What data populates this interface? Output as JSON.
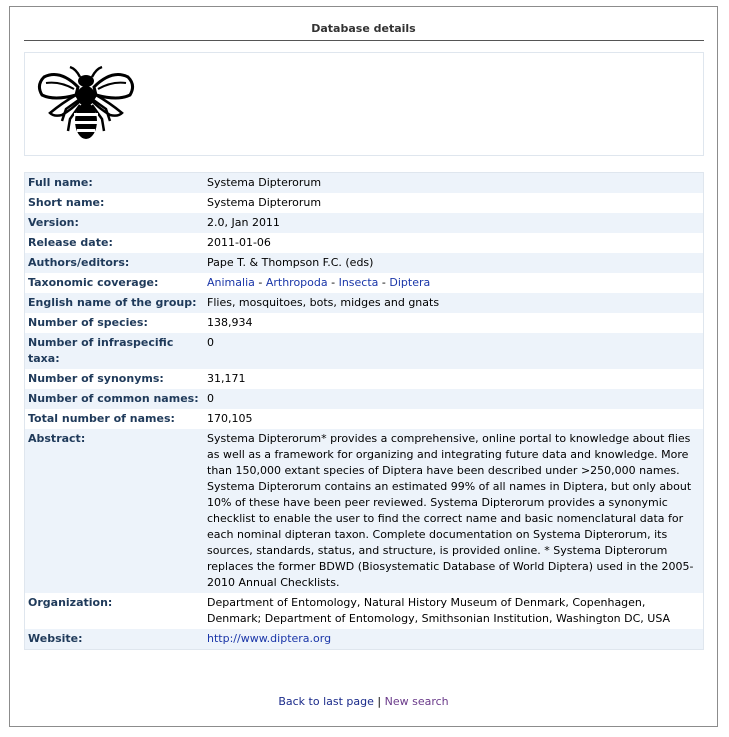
{
  "page": {
    "title": "Database details"
  },
  "logo": {
    "icon": "bee-icon"
  },
  "details": {
    "full_name": {
      "label": "Full name:",
      "value": "Systema Dipterorum"
    },
    "short_name": {
      "label": "Short name:",
      "value": "Systema Dipterorum"
    },
    "version": {
      "label": "Version:",
      "value": "2.0, Jan 2011"
    },
    "release_date": {
      "label": "Release date:",
      "value": "2011-01-06"
    },
    "authors": {
      "label": "Authors/editors:",
      "value": "Pape T. & Thompson F.C. (eds)"
    },
    "taxonomic": {
      "label": "Taxonomic coverage:",
      "items": [
        "Animalia",
        "Arthropoda",
        "Insecta",
        "Diptera"
      ],
      "separator": " - "
    },
    "english_name": {
      "label": "English name of the group:",
      "value": "Flies, mosquitoes, bots, midges and gnats"
    },
    "num_species": {
      "label": "Number of species:",
      "value": "138,934"
    },
    "num_infraspecific": {
      "label": "Number of infraspecific taxa:",
      "value": "0"
    },
    "num_synonyms": {
      "label": "Number of synonyms:",
      "value": "31,171"
    },
    "num_common": {
      "label": "Number of common names:",
      "value": "0"
    },
    "total_names": {
      "label": "Total number of names:",
      "value": "170,105"
    },
    "abstract": {
      "label": "Abstract:",
      "value": "Systema Dipterorum* provides a comprehensive, online portal to knowledge about flies as well as a framework for organizing and integrating future data and knowledge. More than 150,000 extant species of Diptera have been described under >250,000 names. Systema Dipterorum contains an estimated 99% of all names in Diptera, but only about 10% of these have been peer reviewed. Systema Dipterorum provides a synonymic checklist to enable the user to find the correct name and basic nomenclatural data for each nominal dipteran taxon. Complete documentation on Systema Dipterorum, its sources, standards, status, and structure, is provided online. * Systema Dipterorum replaces the former BDWD (Biosystematic Database of World Diptera) used in the 2005-2010 Annual Checklists."
    },
    "organization": {
      "label": "Organization:",
      "value": "Department of Entomology, Natural History Museum of Denmark, Copenhagen, Denmark; Department of Entomology, Smithsonian Institution, Washington DC, USA"
    },
    "website": {
      "label": "Website:",
      "value": "http://www.diptera.org"
    }
  },
  "footer": {
    "back_label": "Back to last page",
    "separator": "|",
    "new_label": "New search"
  },
  "colors": {
    "label_text": "#1f3a5a",
    "row_alt": "#edf3fa",
    "link": "#1a36a8",
    "visited_link": "#6a3a8a"
  }
}
